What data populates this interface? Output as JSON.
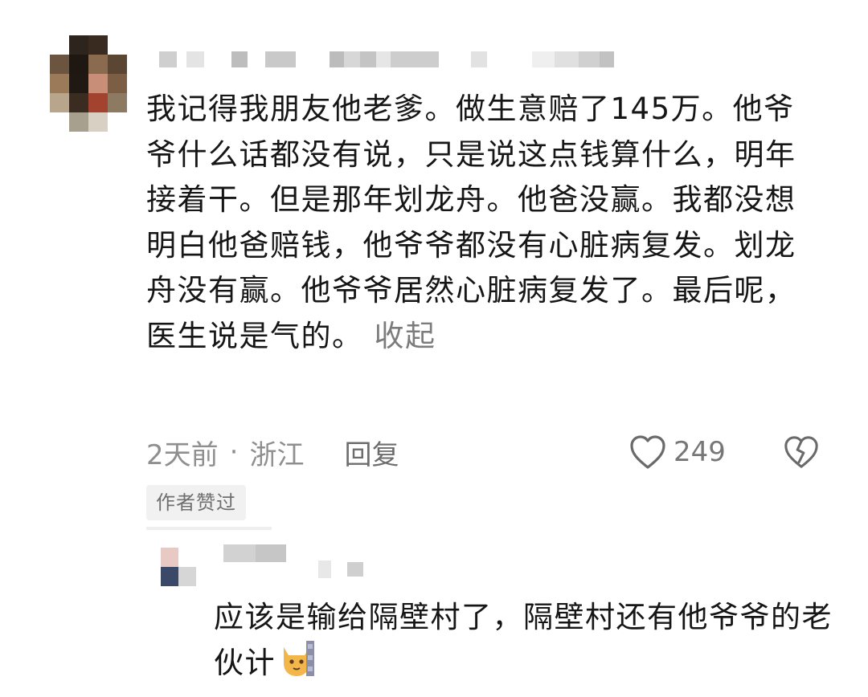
{
  "comment": {
    "text": "我记得我朋友他老爹。做生意赔了145万。他爷爷什么话都没有说，只是说这点钱算什么，明年接着干。但是那年划龙舟。他爸没赢。我都没想明白他爸赔钱，他爷爷都没有心脏病复发。划龙舟没有赢。他爷爷居然心脏病复发了。最后呢，医生说是气的。",
    "collapse_label": "收起",
    "time": "2天前",
    "separator": "·",
    "location": "浙江",
    "reply_label": "回复",
    "like_count": "249",
    "author_badge": "作者赞过",
    "like_icon": "heart-outline-icon",
    "dislike_icon": "broken-heart-icon"
  },
  "reply": {
    "text": "应该是输给隔壁村了，隔壁村还有他爷爷的老伙计",
    "emoji_icon": "cat-emoji-icon"
  },
  "colors": {
    "text": "#161616",
    "meta": "#8f8f8f",
    "badge_bg": "#f1f1f1"
  }
}
